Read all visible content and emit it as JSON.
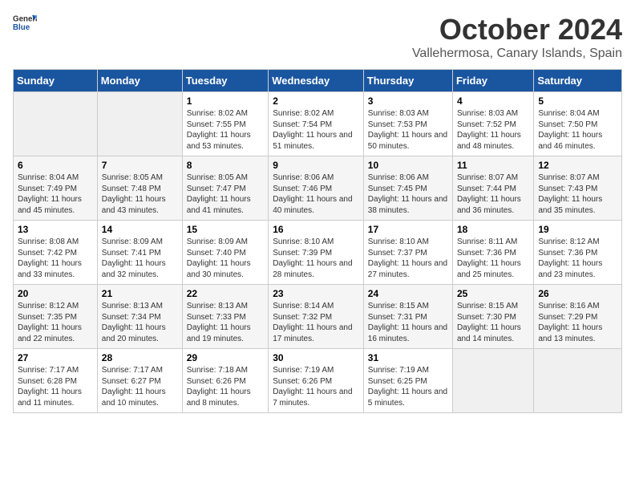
{
  "header": {
    "logo_general": "General",
    "logo_blue": "Blue",
    "month_title": "October 2024",
    "subtitle": "Vallehermosa, Canary Islands, Spain"
  },
  "weekdays": [
    "Sunday",
    "Monday",
    "Tuesday",
    "Wednesday",
    "Thursday",
    "Friday",
    "Saturday"
  ],
  "weeks": [
    [
      {
        "day": "",
        "detail": ""
      },
      {
        "day": "",
        "detail": ""
      },
      {
        "day": "1",
        "detail": "Sunrise: 8:02 AM\nSunset: 7:55 PM\nDaylight: 11 hours and 53 minutes."
      },
      {
        "day": "2",
        "detail": "Sunrise: 8:02 AM\nSunset: 7:54 PM\nDaylight: 11 hours and 51 minutes."
      },
      {
        "day": "3",
        "detail": "Sunrise: 8:03 AM\nSunset: 7:53 PM\nDaylight: 11 hours and 50 minutes."
      },
      {
        "day": "4",
        "detail": "Sunrise: 8:03 AM\nSunset: 7:52 PM\nDaylight: 11 hours and 48 minutes."
      },
      {
        "day": "5",
        "detail": "Sunrise: 8:04 AM\nSunset: 7:50 PM\nDaylight: 11 hours and 46 minutes."
      }
    ],
    [
      {
        "day": "6",
        "detail": "Sunrise: 8:04 AM\nSunset: 7:49 PM\nDaylight: 11 hours and 45 minutes."
      },
      {
        "day": "7",
        "detail": "Sunrise: 8:05 AM\nSunset: 7:48 PM\nDaylight: 11 hours and 43 minutes."
      },
      {
        "day": "8",
        "detail": "Sunrise: 8:05 AM\nSunset: 7:47 PM\nDaylight: 11 hours and 41 minutes."
      },
      {
        "day": "9",
        "detail": "Sunrise: 8:06 AM\nSunset: 7:46 PM\nDaylight: 11 hours and 40 minutes."
      },
      {
        "day": "10",
        "detail": "Sunrise: 8:06 AM\nSunset: 7:45 PM\nDaylight: 11 hours and 38 minutes."
      },
      {
        "day": "11",
        "detail": "Sunrise: 8:07 AM\nSunset: 7:44 PM\nDaylight: 11 hours and 36 minutes."
      },
      {
        "day": "12",
        "detail": "Sunrise: 8:07 AM\nSunset: 7:43 PM\nDaylight: 11 hours and 35 minutes."
      }
    ],
    [
      {
        "day": "13",
        "detail": "Sunrise: 8:08 AM\nSunset: 7:42 PM\nDaylight: 11 hours and 33 minutes."
      },
      {
        "day": "14",
        "detail": "Sunrise: 8:09 AM\nSunset: 7:41 PM\nDaylight: 11 hours and 32 minutes."
      },
      {
        "day": "15",
        "detail": "Sunrise: 8:09 AM\nSunset: 7:40 PM\nDaylight: 11 hours and 30 minutes."
      },
      {
        "day": "16",
        "detail": "Sunrise: 8:10 AM\nSunset: 7:39 PM\nDaylight: 11 hours and 28 minutes."
      },
      {
        "day": "17",
        "detail": "Sunrise: 8:10 AM\nSunset: 7:37 PM\nDaylight: 11 hours and 27 minutes."
      },
      {
        "day": "18",
        "detail": "Sunrise: 8:11 AM\nSunset: 7:36 PM\nDaylight: 11 hours and 25 minutes."
      },
      {
        "day": "19",
        "detail": "Sunrise: 8:12 AM\nSunset: 7:36 PM\nDaylight: 11 hours and 23 minutes."
      }
    ],
    [
      {
        "day": "20",
        "detail": "Sunrise: 8:12 AM\nSunset: 7:35 PM\nDaylight: 11 hours and 22 minutes."
      },
      {
        "day": "21",
        "detail": "Sunrise: 8:13 AM\nSunset: 7:34 PM\nDaylight: 11 hours and 20 minutes."
      },
      {
        "day": "22",
        "detail": "Sunrise: 8:13 AM\nSunset: 7:33 PM\nDaylight: 11 hours and 19 minutes."
      },
      {
        "day": "23",
        "detail": "Sunrise: 8:14 AM\nSunset: 7:32 PM\nDaylight: 11 hours and 17 minutes."
      },
      {
        "day": "24",
        "detail": "Sunrise: 8:15 AM\nSunset: 7:31 PM\nDaylight: 11 hours and 16 minutes."
      },
      {
        "day": "25",
        "detail": "Sunrise: 8:15 AM\nSunset: 7:30 PM\nDaylight: 11 hours and 14 minutes."
      },
      {
        "day": "26",
        "detail": "Sunrise: 8:16 AM\nSunset: 7:29 PM\nDaylight: 11 hours and 13 minutes."
      }
    ],
    [
      {
        "day": "27",
        "detail": "Sunrise: 7:17 AM\nSunset: 6:28 PM\nDaylight: 11 hours and 11 minutes."
      },
      {
        "day": "28",
        "detail": "Sunrise: 7:17 AM\nSunset: 6:27 PM\nDaylight: 11 hours and 10 minutes."
      },
      {
        "day": "29",
        "detail": "Sunrise: 7:18 AM\nSunset: 6:26 PM\nDaylight: 11 hours and 8 minutes."
      },
      {
        "day": "30",
        "detail": "Sunrise: 7:19 AM\nSunset: 6:26 PM\nDaylight: 11 hours and 7 minutes."
      },
      {
        "day": "31",
        "detail": "Sunrise: 7:19 AM\nSunset: 6:25 PM\nDaylight: 11 hours and 5 minutes."
      },
      {
        "day": "",
        "detail": ""
      },
      {
        "day": "",
        "detail": ""
      }
    ]
  ]
}
